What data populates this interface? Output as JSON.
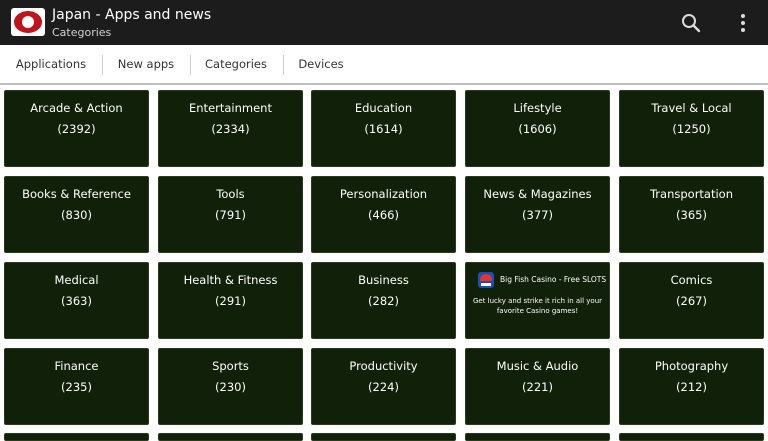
{
  "appbar": {
    "title": "Japan - Apps and news",
    "subtitle": "Categories",
    "icon": "japan-flag-icon",
    "search_icon": "search-icon",
    "overflow_icon": "more-vert-icon"
  },
  "tabs": [
    {
      "label": "Applications"
    },
    {
      "label": "New apps"
    },
    {
      "label": "Categories"
    },
    {
      "label": "Devices"
    }
  ],
  "categories": [
    {
      "name": "Arcade & Action",
      "count": "(2392)"
    },
    {
      "name": "Entertainment",
      "count": "(2334)"
    },
    {
      "name": "Education",
      "count": "(1614)"
    },
    {
      "name": "Lifestyle",
      "count": "(1606)"
    },
    {
      "name": "Travel & Local",
      "count": "(1250)"
    },
    {
      "name": "Books & Reference",
      "count": "(830)"
    },
    {
      "name": "Tools",
      "count": "(791)"
    },
    {
      "name": "Personalization",
      "count": "(466)"
    },
    {
      "name": "News & Magazines",
      "count": "(377)"
    },
    {
      "name": "Transportation",
      "count": "(365)"
    },
    {
      "name": "Medical",
      "count": "(363)"
    },
    {
      "name": "Health & Fitness",
      "count": "(291)"
    },
    {
      "name": "Business",
      "count": "(282)"
    },
    {
      "name": "Comics",
      "count": "(267)"
    },
    {
      "name": "Finance",
      "count": "(235)"
    },
    {
      "name": "Sports",
      "count": "(230)"
    },
    {
      "name": "Productivity",
      "count": "(224)"
    },
    {
      "name": "Music & Audio",
      "count": "(221)"
    },
    {
      "name": "Photography",
      "count": "(212)"
    }
  ],
  "ad": {
    "title": "Big Fish Casino - Free SLOTS",
    "body": "Get lucky and strike it rich in all your favorite Casino games!",
    "icon": "casino-app-icon"
  },
  "colors": {
    "appbar_bg": "#1c1c1c",
    "tile_bg": "#112008",
    "flag_red": "#c0141c"
  }
}
